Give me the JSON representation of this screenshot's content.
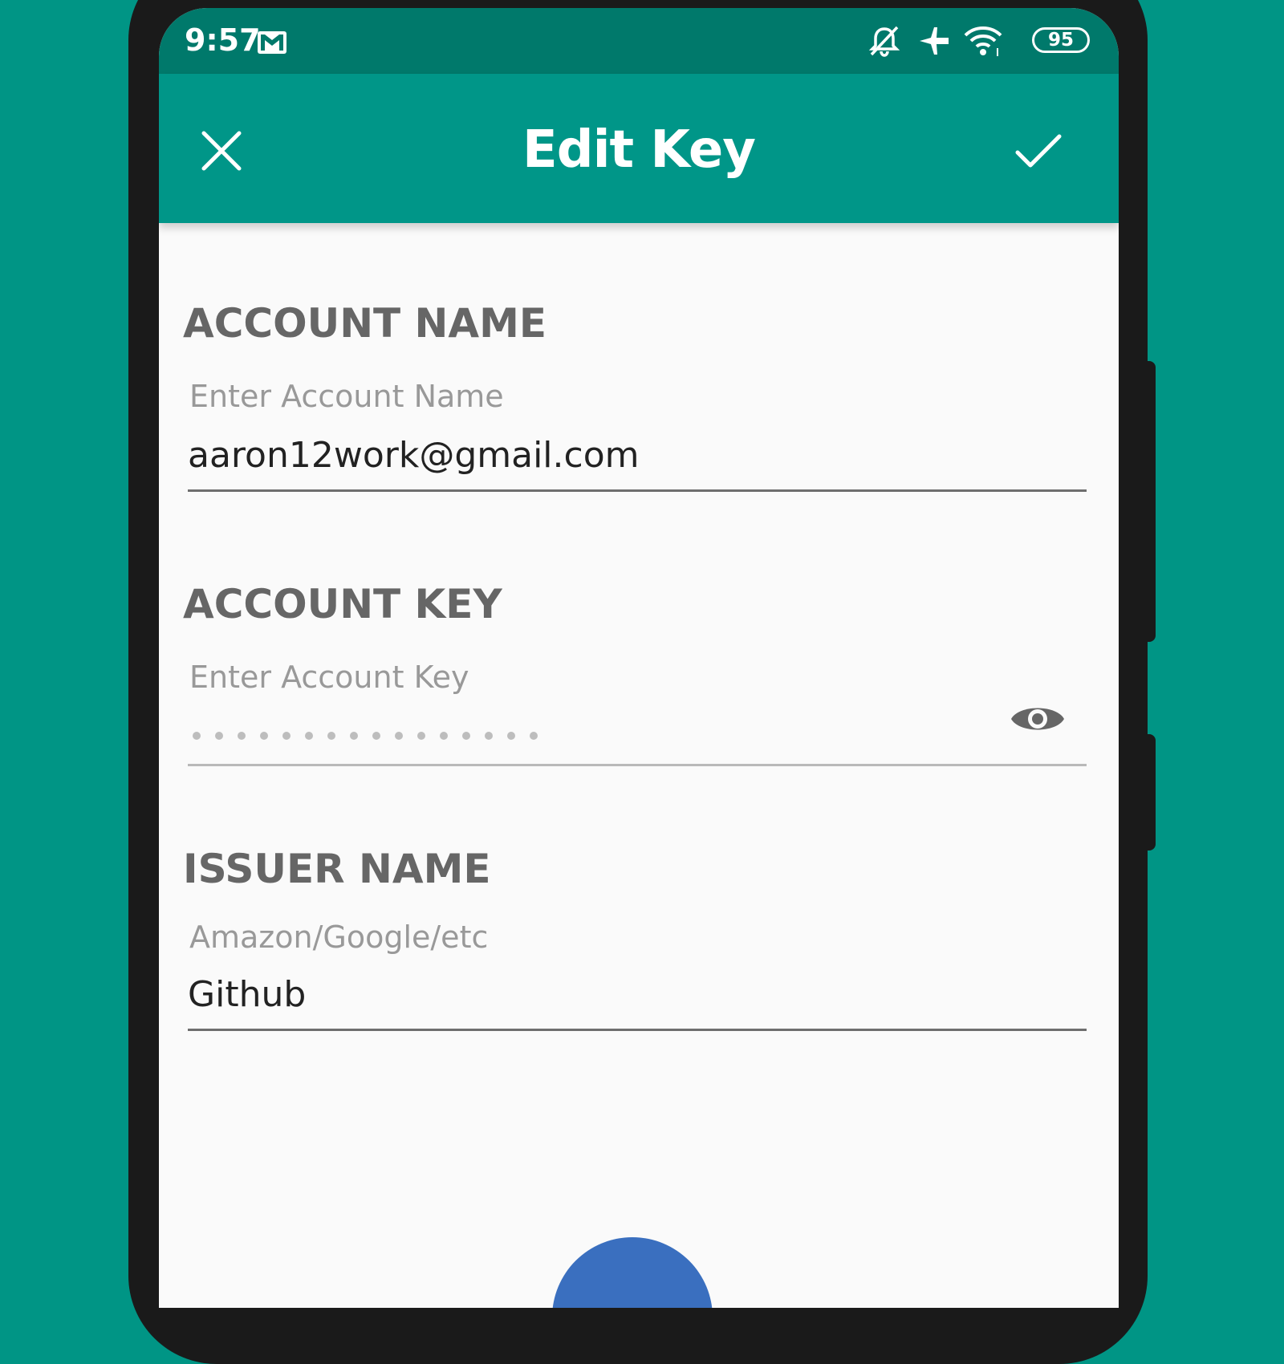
{
  "status_bar": {
    "time": "9:57",
    "battery": "95",
    "icons": [
      "gmail-icon",
      "bell-off-icon",
      "airplane-icon",
      "wifi-icon",
      "battery-icon"
    ]
  },
  "app_bar": {
    "title": "Edit Key",
    "close_icon": "close-icon",
    "confirm_icon": "check-icon"
  },
  "form": {
    "account_name": {
      "label": "ACCOUNT NAME",
      "hint": "Enter Account Name",
      "value": "aaron12work@gmail.com"
    },
    "account_key": {
      "label": "ACCOUNT KEY",
      "hint": "Enter Account Key",
      "masked_length": 16,
      "toggle_icon": "eye-icon"
    },
    "issuer_name": {
      "label": "ISSUER NAME",
      "hint": "Amazon/Google/etc",
      "value": "Github"
    }
  },
  "colors": {
    "background": "#009585",
    "status_bar": "#00796b",
    "app_bar": "#009688",
    "label": "#666666",
    "hint": "#999999",
    "fab": "#3a6fbf"
  }
}
